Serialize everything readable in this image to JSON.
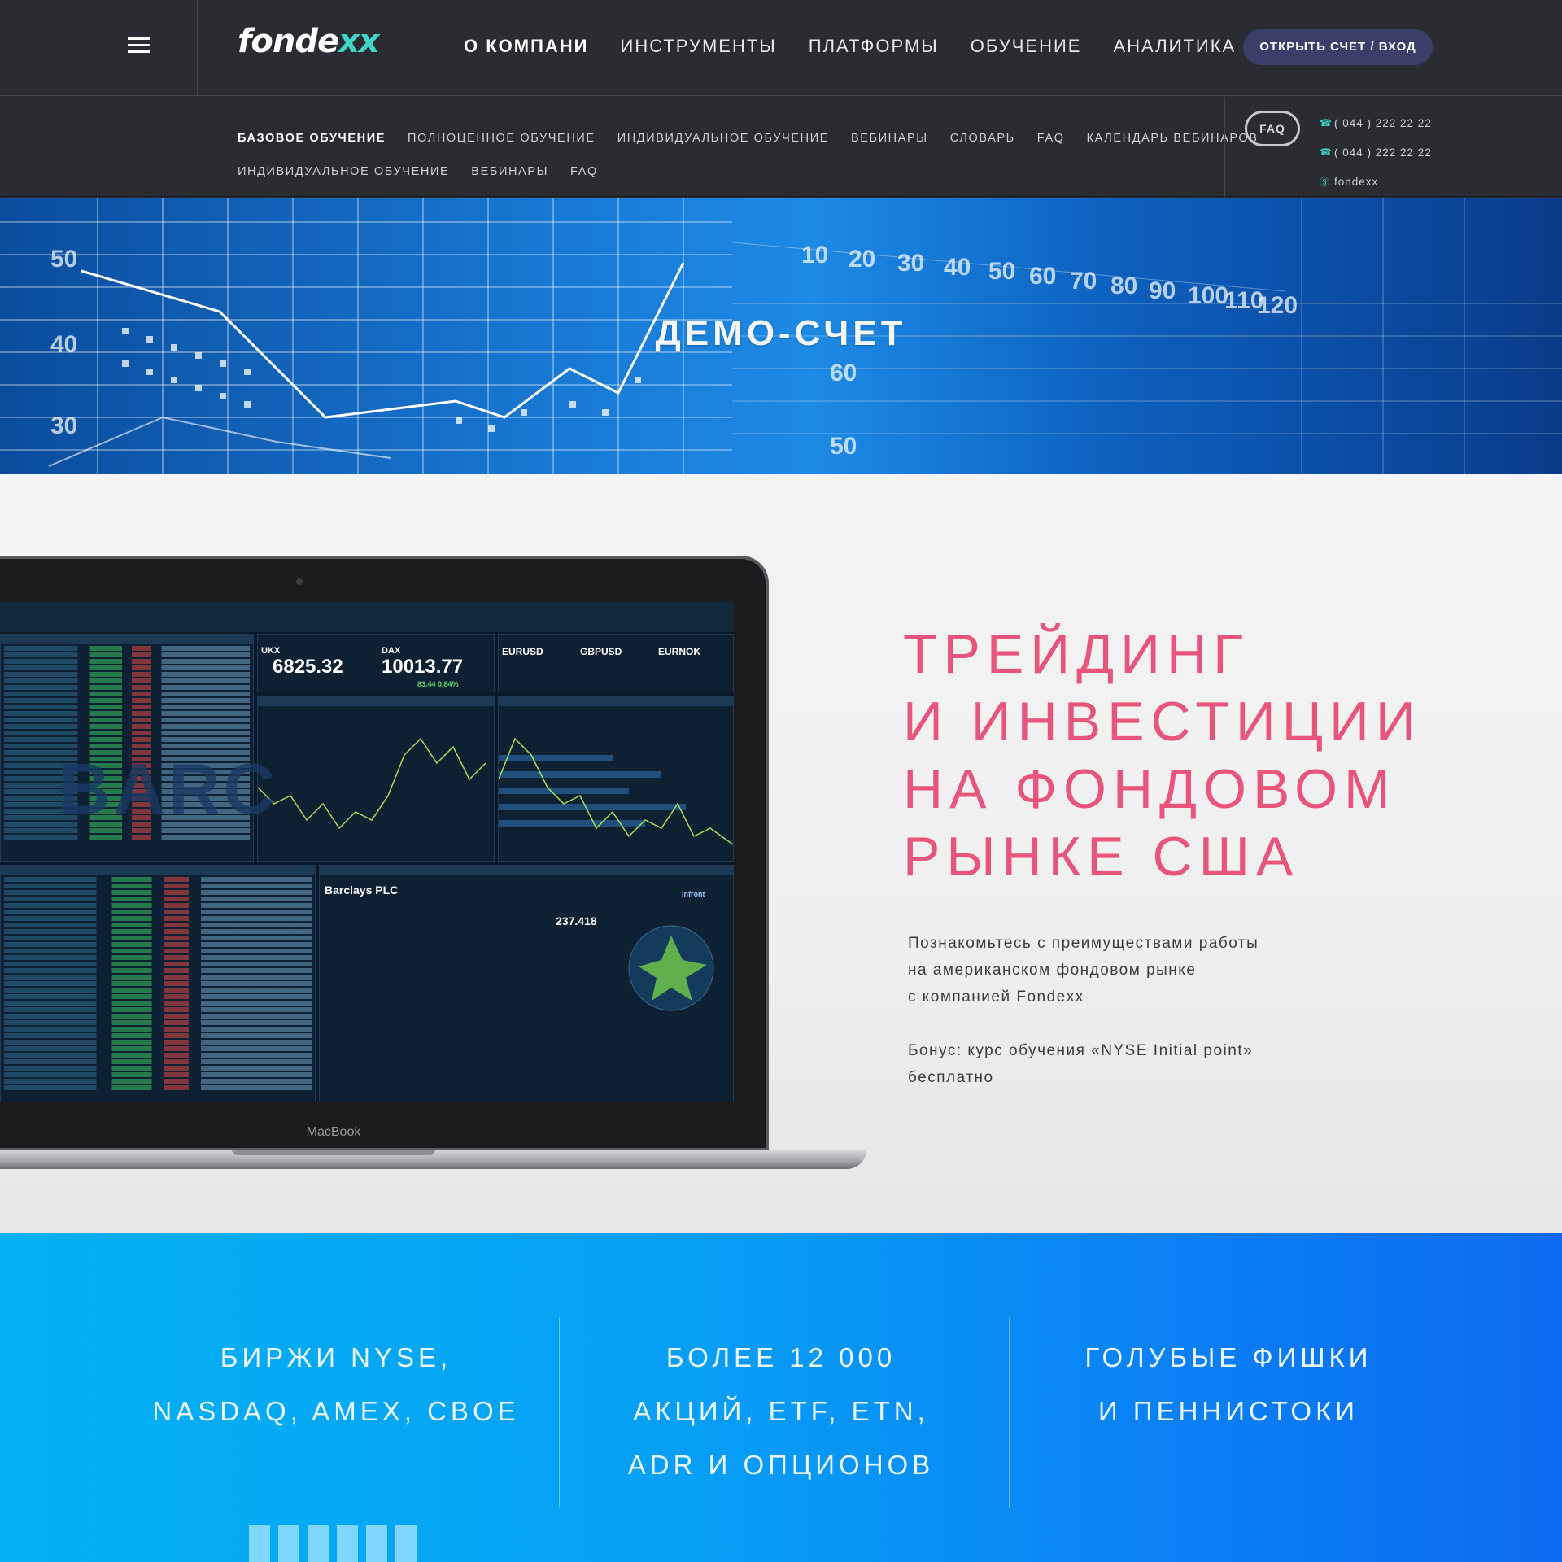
{
  "header": {
    "logo_main": "fonde",
    "logo_accent": "xx",
    "nav": [
      "О КОМПАНИ",
      "ИНСТРУМЕНТЫ",
      "ПЛАТФОРМЫ",
      "ОБУЧЕНИЕ",
      "АНАЛИТИКА"
    ],
    "cta": "ОТКРЫТЬ СЧЕТ / ВХОД"
  },
  "subnav": {
    "row1": [
      "БАЗОВОЕ ОБУЧЕНИЕ",
      "ПОЛНОЦЕННОЕ ОБУЧЕНИЕ",
      "ИНДИВИДУАЛЬНОЕ ОБУЧЕНИЕ",
      "ВЕБИНАРЫ",
      "СЛОВАРЬ",
      "FAQ",
      "КАЛЕНДАРЬ ВЕБИНАРОВ"
    ],
    "row2": [
      "ИНДИВИДУАЛЬНОЕ ОБУЧЕНИЕ",
      "ВЕБИНАРЫ",
      "FAQ"
    ],
    "faq_button": "FAQ",
    "phone1": "( 044 ) 222 22 22",
    "phone2": "( 044 ) 222 22 22",
    "skype": "fondexx"
  },
  "hero": {
    "title": "ДЕМО-СЧЕТ",
    "bg_numbers_left": [
      "50",
      "40",
      "30"
    ],
    "bg_numbers_top": [
      "10",
      "20",
      "30",
      "40",
      "50",
      "60",
      "70",
      "80",
      "90",
      "100",
      "110",
      "120"
    ],
    "bg_numbers_right": [
      "60",
      "50"
    ]
  },
  "promo": {
    "headline": [
      "ТРЕЙДИНГ",
      "И ИНВЕСТИЦИИ",
      "НА ФОНДОВОМ",
      "РЫНКЕ США"
    ],
    "description": [
      "Познакомьтесь с преимуществами работы",
      "на американском фондовом рынке",
      "с компанией Fondexx"
    ],
    "bonus": [
      "Бонус: курс обучения «NYSE Initial point»",
      "бесплатно"
    ],
    "laptop_brand": "MacBook",
    "terminal": {
      "ukx_label": "UKX",
      "ukx_value": "6825.32",
      "dax_label": "DAX",
      "dax_value": "10013.77",
      "dax_change": "83.44 0.84%",
      "fx": [
        "EURUSD",
        "GBPUSD",
        "EURNOK"
      ],
      "company": "Barclays PLC",
      "last_price": "237.418",
      "watermark": "BARC",
      "vendor": "Infront"
    }
  },
  "features": [
    {
      "lines": [
        "БИРЖИ NYSE,",
        "NASDAQ, AMEX, CBOE"
      ]
    },
    {
      "lines": [
        "БОЛЕЕ 12 000",
        "АКЦИЙ, ETF, ETN,",
        "ADR И ОПЦИОНОВ"
      ]
    },
    {
      "lines": [
        "ГОЛУБЫЕ ФИШКИ",
        "И ПЕННИСТОКИ"
      ]
    }
  ],
  "colors": {
    "accent_pink": "#e8547b",
    "header_bg": "#2b2c31",
    "cta_bg": "#3a3f6a",
    "teal": "#3fd6c8",
    "feature_blue": "#079ef5"
  }
}
